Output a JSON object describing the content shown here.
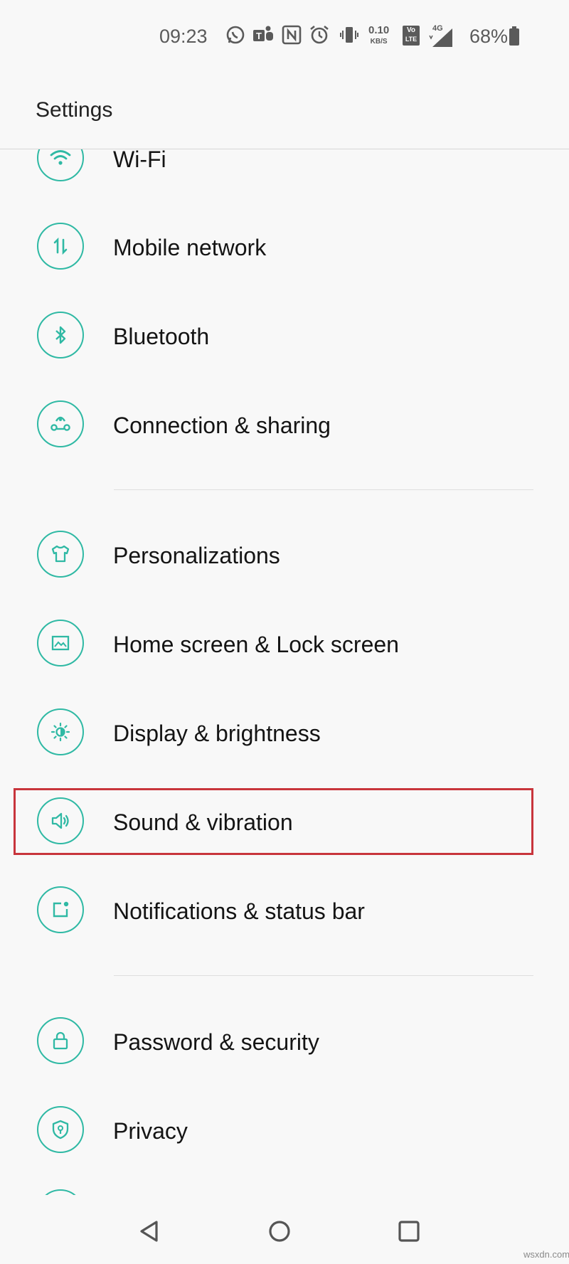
{
  "status_bar": {
    "time": "09:23",
    "net_speed_value": "0.10",
    "net_speed_unit": "KB/S",
    "network_label": "4G",
    "volte_top": "Vo",
    "volte_bottom": "LTE",
    "battery": "68%",
    "icons": [
      "whatsapp-icon",
      "teams-icon",
      "nfc-icon",
      "alarm-icon",
      "vibrate-icon",
      "volte-icon",
      "signal-icon",
      "battery-icon"
    ]
  },
  "header": {
    "title": "Settings"
  },
  "settings_items": [
    {
      "label": "Wi-Fi",
      "icon": "wifi-icon"
    },
    {
      "label": "Mobile network",
      "icon": "mobile-data-icon"
    },
    {
      "label": "Bluetooth",
      "icon": "bluetooth-icon"
    },
    {
      "label": "Connection & sharing",
      "icon": "share-icon"
    },
    {
      "label": "Personalizations",
      "icon": "tshirt-icon"
    },
    {
      "label": "Home screen & Lock screen",
      "icon": "image-icon"
    },
    {
      "label": "Display & brightness",
      "icon": "brightness-icon"
    },
    {
      "label": "Sound & vibration",
      "icon": "speaker-icon",
      "highlighted": true
    },
    {
      "label": "Notifications & status bar",
      "icon": "notification-icon"
    },
    {
      "label": "Password & security",
      "icon": "lock-icon"
    },
    {
      "label": "Privacy",
      "icon": "privacy-shield-icon"
    }
  ],
  "navigation": {
    "buttons": [
      "back-icon",
      "home-icon",
      "recents-icon"
    ]
  },
  "watermark": "wsxdn.com",
  "colors": {
    "accent": "#2fb9a4",
    "highlight_border": "#c8353c",
    "background": "#f8f8f8"
  }
}
